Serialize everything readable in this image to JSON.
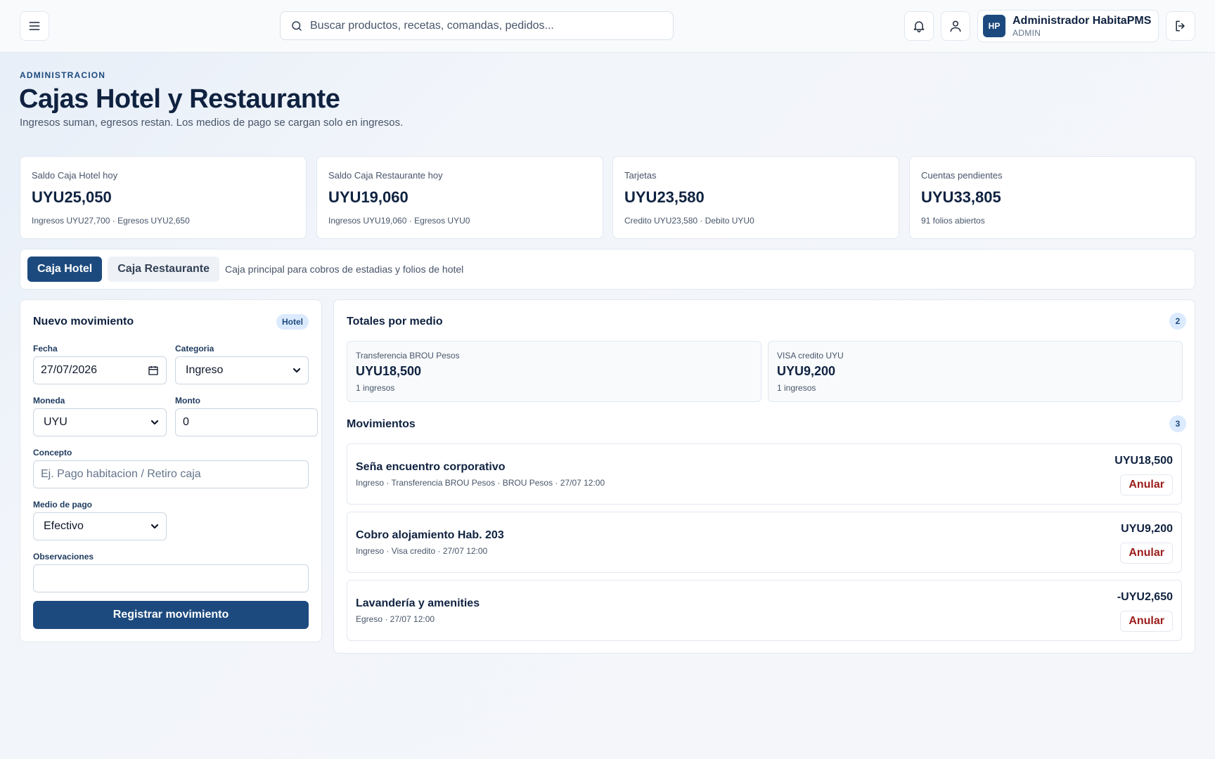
{
  "topbar": {
    "search_placeholder": "Buscar productos, recetas, comandas, pedidos...",
    "user": {
      "initials": "HP",
      "name": "Administrador HabitaPMS",
      "role": "ADMIN"
    }
  },
  "header": {
    "eyebrow": "ADMINISTRACION",
    "title": "Cajas Hotel y Restaurante",
    "subtitle": "Ingresos suman, egresos restan. Los medios de pago se cargan solo en ingresos."
  },
  "stats": [
    {
      "label": "Saldo Caja Hotel hoy",
      "value": "UYU25,050",
      "detail": "Ingresos UYU27,700 · Egresos UYU2,650"
    },
    {
      "label": "Saldo Caja Restaurante hoy",
      "value": "UYU19,060",
      "detail": "Ingresos UYU19,060 · Egresos UYU0"
    },
    {
      "label": "Tarjetas",
      "value": "UYU23,580",
      "detail": "Credito UYU23,580 · Debito UYU0"
    },
    {
      "label": "Cuentas pendientes",
      "value": "UYU33,805",
      "detail": "91 folios abiertos"
    }
  ],
  "tabs": {
    "hotel": "Caja Hotel",
    "restaurante": "Caja Restaurante",
    "description": "Caja principal para cobros de estadias y folios de hotel"
  },
  "form": {
    "title": "Nuevo movimiento",
    "badge": "Hotel",
    "fecha_label": "Fecha",
    "fecha_value": "27/07/2026",
    "categoria_label": "Categoria",
    "categoria_value": "Ingreso",
    "moneda_label": "Moneda",
    "moneda_value": "UYU",
    "monto_label": "Monto",
    "monto_value": "0",
    "concepto_label": "Concepto",
    "concepto_placeholder": "Ej. Pago habitacion / Retiro caja",
    "medio_label": "Medio de pago",
    "medio_value": "Efectivo",
    "obs_label": "Observaciones",
    "obs_value": "",
    "submit": "Registrar movimiento"
  },
  "totales": {
    "title": "Totales por medio",
    "count": "2",
    "items": [
      {
        "name": "Transferencia BROU Pesos",
        "value": "UYU18,500",
        "count": "1 ingresos"
      },
      {
        "name": "VISA credito UYU",
        "value": "UYU9,200",
        "count": "1 ingresos"
      }
    ]
  },
  "movimientos": {
    "title": "Movimientos",
    "count": "3",
    "anular_label": "Anular",
    "items": [
      {
        "title": "Seña encuentro corporativo",
        "meta": "Ingreso · Transferencia BROU Pesos · BROU Pesos · 27/07 12:00",
        "amount": "UYU18,500"
      },
      {
        "title": "Cobro alojamiento Hab. 203",
        "meta": "Ingreso · Visa credito · 27/07 12:00",
        "amount": "UYU9,200"
      },
      {
        "title": "Lavandería y amenities",
        "meta": "Egreso · 27/07 12:00",
        "amount": "-UYU2,650"
      }
    ]
  }
}
